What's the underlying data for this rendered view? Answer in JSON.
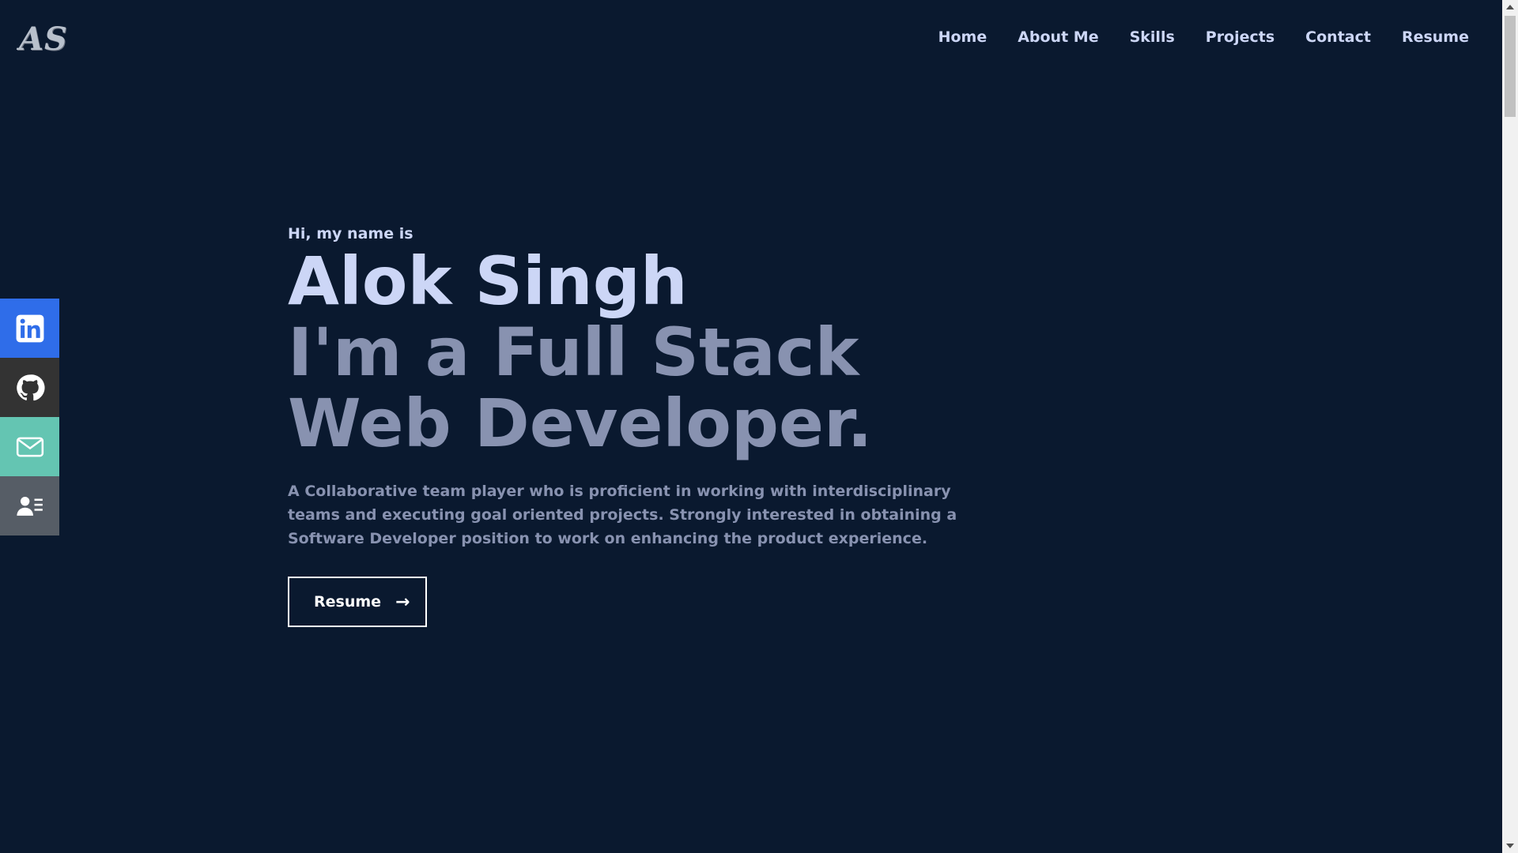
{
  "header": {
    "logo": "AS",
    "nav": [
      "Home",
      "About Me",
      "Skills",
      "Projects",
      "Contact",
      "Resume"
    ]
  },
  "social": [
    {
      "icon": "linkedin-icon",
      "color": "#2f6de9"
    },
    {
      "icon": "github-icon",
      "color": "#333333"
    },
    {
      "icon": "mail-icon",
      "color": "#64c5b2"
    },
    {
      "icon": "resume-icon",
      "color": "#565d66"
    }
  ],
  "hero": {
    "greeting": "Hi, my name is",
    "name": "Alok Singh",
    "role": "I'm a Full Stack Web Developer.",
    "description": "A Collaborative team player who is proficient in working with interdisciplinary teams and executing goal oriented projects. Strongly interested in obtaining a Software Developer position to work on enhancing the product experience.",
    "button_label": "Resume",
    "button_arrow": "→"
  },
  "colors": {
    "background": "#0a192f",
    "heading": "#ccd6f6",
    "muted": "#8892b0"
  }
}
